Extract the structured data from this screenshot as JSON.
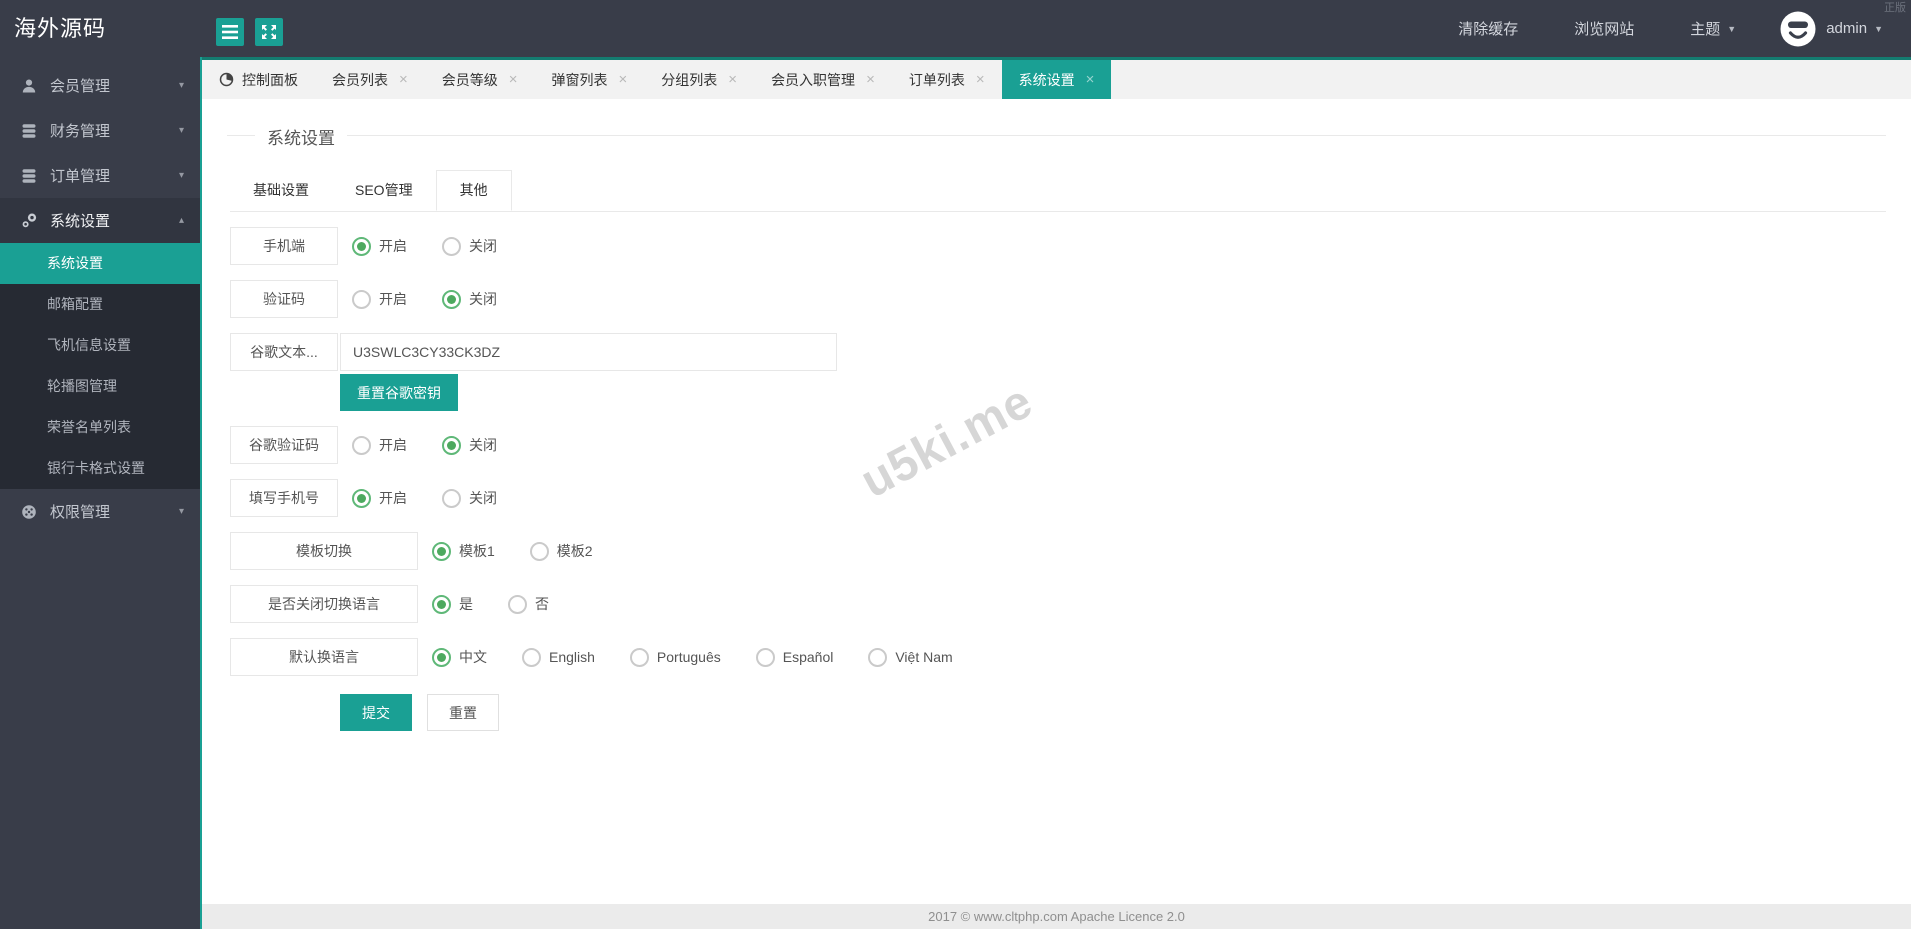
{
  "topbar": {
    "logo": "海外源码",
    "corner_text": "正版",
    "clear_cache": "清除缓存",
    "browse_site": "浏览网站",
    "theme": "主题",
    "username": "admin"
  },
  "glyphs": {
    "caret_down": "▾",
    "caret_up": "▴",
    "caret_small": "▼",
    "close": "×"
  },
  "sidebar": {
    "items": [
      {
        "label": "会员管理"
      },
      {
        "label": "财务管理"
      },
      {
        "label": "订单管理"
      },
      {
        "label": "系统设置",
        "expanded": true
      },
      {
        "label": "权限管理"
      }
    ],
    "system_children": [
      {
        "label": "系统设置",
        "active": true
      },
      {
        "label": "邮箱配置"
      },
      {
        "label": "飞机信息设置"
      },
      {
        "label": "轮播图管理"
      },
      {
        "label": "荣誉名单列表"
      },
      {
        "label": "银行卡格式设置"
      }
    ]
  },
  "tabbar": {
    "tabs": [
      {
        "label": "控制面板",
        "closable": false
      },
      {
        "label": "会员列表",
        "closable": true
      },
      {
        "label": "会员等级",
        "closable": true
      },
      {
        "label": "弹窗列表",
        "closable": true
      },
      {
        "label": "分组列表",
        "closable": true
      },
      {
        "label": "会员入职管理",
        "closable": true
      },
      {
        "label": "订单列表",
        "closable": true
      },
      {
        "label": "系统设置",
        "closable": true,
        "active": true
      }
    ]
  },
  "panel": {
    "title": "系统设置",
    "tabs": [
      {
        "label": "基础设置"
      },
      {
        "label": "SEO管理"
      },
      {
        "label": "其他",
        "active": true
      }
    ],
    "form": {
      "rows": [
        {
          "label": "手机端",
          "type": "radio",
          "options": [
            "开启",
            "关闭"
          ],
          "selected": "开启"
        },
        {
          "label": "验证码",
          "type": "radio",
          "options": [
            "开启",
            "关闭"
          ],
          "selected": "关闭"
        },
        {
          "label": "谷歌文本...",
          "type": "text",
          "value": "U3SWLC3CY33CK3DZ",
          "button": "重置谷歌密钥"
        },
        {
          "label": "谷歌验证码",
          "type": "radio",
          "options": [
            "开启",
            "关闭"
          ],
          "selected": "关闭"
        },
        {
          "label": "填写手机号",
          "type": "radio",
          "options": [
            "开启",
            "关闭"
          ],
          "selected": "开启"
        },
        {
          "label": "模板切换",
          "type": "radio",
          "options": [
            "模板1",
            "模板2"
          ],
          "selected": "模板1"
        },
        {
          "label": "是否关闭切换语言",
          "type": "radio",
          "options": [
            "是",
            "否"
          ],
          "selected": "是"
        },
        {
          "label": "默认换语言",
          "type": "radio",
          "options": [
            "中文",
            "English",
            "Português",
            "Español",
            "Việt Nam"
          ],
          "selected": "中文"
        }
      ],
      "submit": "提交",
      "reset": "重置"
    },
    "watermark": "u5ki.me"
  },
  "footer": {
    "text": "2017 ©  www.cltphp.com  Apache Licence 2.0"
  },
  "colors": {
    "dark": "#393D49",
    "dark_expanded": "#313540",
    "dark_subnav": "#262A33",
    "accent_teal": "#1AA094",
    "tab_strip": "#147C70",
    "radio_green": "#5FB878",
    "footer_bg": "#ebebeb"
  }
}
